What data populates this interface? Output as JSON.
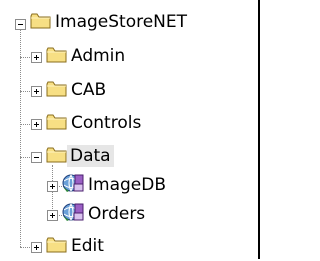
{
  "tree": {
    "root": {
      "label": "ImageStoreNET",
      "icon": "folder-icon",
      "expanded": true
    },
    "children": [
      {
        "label": "Admin",
        "icon": "folder-icon",
        "expanded": false
      },
      {
        "label": "CAB",
        "icon": "folder-icon",
        "expanded": false
      },
      {
        "label": "Controls",
        "icon": "folder-icon",
        "expanded": false
      },
      {
        "label": "Data",
        "icon": "folder-icon",
        "expanded": true,
        "selected": true,
        "children": [
          {
            "label": "ImageDB",
            "icon": "web-service-icon",
            "expanded": false
          },
          {
            "label": "Orders",
            "icon": "web-service-icon",
            "expanded": false
          }
        ]
      },
      {
        "label": "Edit",
        "icon": "folder-icon",
        "expanded": false
      }
    ]
  },
  "colors": {
    "folder_fill": "#f7df84",
    "folder_outline": "#8a6d1c",
    "selection": "#e6e6e6",
    "connector": "#8c8c8c"
  }
}
